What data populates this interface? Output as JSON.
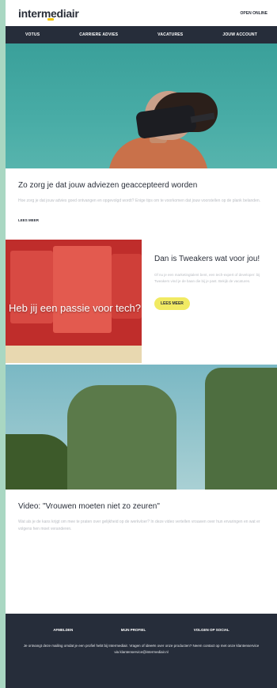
{
  "header": {
    "logo": "intermediair",
    "open_online": "OPEN ONLINE"
  },
  "nav": {
    "items": [
      "VOTUS",
      "CARRIERE ADVIES",
      "VACATURES",
      "JOUW ACCOUNT"
    ]
  },
  "article1": {
    "title": "Zo zorg je dat jouw adviezen geaccepteerd worden",
    "text": "Hoe zorg je dat jouw advies goed ontvangen en opgevolgd wordt? Enige tips om te voorkomen dat jouw voorstellen op de plank belanden.",
    "link": "LEES MEER"
  },
  "promo": {
    "headline": "Heb jij een passie voor tech?",
    "title": "Dan is Tweakers wat voor jou!",
    "text": "Of nu je een marketingtalent bent, een tech-expert of developer: bij Tweakers vind je de baan die bij je past. Bekijk de vacatures.",
    "button": "LEES MEER"
  },
  "article2": {
    "title": "Video: \"Vrouwen moeten niet zo zeuren\"",
    "text": "Wat als je de kans krijgt om mee te praten over gelijkheid op de werkvloer? In deze video vertellen vrouwen over hun ervaringen en wat er volgens hen moet veranderen."
  },
  "footer": {
    "links": [
      "AFMELDEN",
      "MIJN PROFIEL",
      "VOLGEN OP SOCIAL"
    ],
    "text": "Je ontvangt deze mailing omdat je een profiel hebt bij Intermediair. Vragen of ideeën over onze producten? Neem contact op met onze klantenservice via klantenservice@intermediair.nl"
  },
  "colors": {
    "nav_bg": "#262d3a",
    "button_bg": "#f1ea63",
    "hero_bg": "#48aca6"
  }
}
